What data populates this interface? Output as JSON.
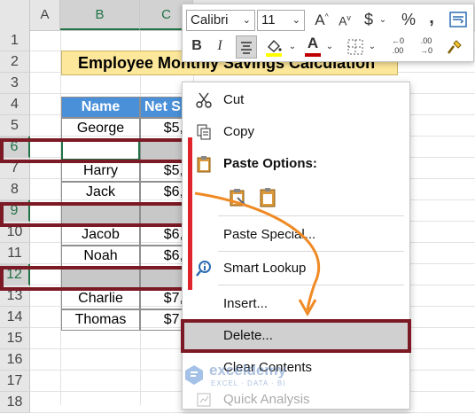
{
  "columns": [
    {
      "label": "A",
      "selected": false
    },
    {
      "label": "B",
      "selected": true
    },
    {
      "label": "C",
      "selected": true
    }
  ],
  "rows": [
    {
      "num": "1",
      "selected": false
    },
    {
      "num": "2",
      "selected": false
    },
    {
      "num": "3",
      "selected": false
    },
    {
      "num": "4",
      "selected": false
    },
    {
      "num": "5",
      "selected": false
    },
    {
      "num": "6",
      "selected": true
    },
    {
      "num": "7",
      "selected": false
    },
    {
      "num": "8",
      "selected": false
    },
    {
      "num": "9",
      "selected": true
    },
    {
      "num": "10",
      "selected": false
    },
    {
      "num": "11",
      "selected": false
    },
    {
      "num": "12",
      "selected": true
    },
    {
      "num": "13",
      "selected": false
    },
    {
      "num": "14",
      "selected": false
    },
    {
      "num": "15",
      "selected": false
    },
    {
      "num": "16",
      "selected": false
    },
    {
      "num": "17",
      "selected": false
    },
    {
      "num": "18",
      "selected": false
    }
  ],
  "sheet": {
    "title": "Employee Monthly Savings Calculation",
    "headers": [
      "Name",
      "Net S"
    ],
    "records": [
      {
        "name": "George",
        "net": "$5,"
      },
      {
        "name": "",
        "net": ""
      },
      {
        "name": "Harry",
        "net": "$5,"
      },
      {
        "name": "Jack",
        "net": "$6,"
      },
      {
        "name": "",
        "net": ""
      },
      {
        "name": "Jacob",
        "net": "$6,"
      },
      {
        "name": "Noah",
        "net": "$6,"
      },
      {
        "name": "",
        "net": ""
      },
      {
        "name": "Charlie",
        "net": "$7,"
      },
      {
        "name": "Thomas",
        "net": "$7,"
      }
    ]
  },
  "mini_toolbar": {
    "font_name": "Calibri",
    "font_size": "11",
    "grow_font": "A",
    "shrink_font": "A",
    "currency": "$",
    "percent": "%",
    "comma": ",",
    "bold": "B",
    "italic": "I",
    "font_color_letter": "A",
    "dec_increase_top": "←0",
    "dec_increase_bottom": ".00",
    "dec_decrease_top": ".00",
    "dec_decrease_bottom": "→0",
    "font_color_accent": "#ffff00",
    "font_color_bar": "#c00000"
  },
  "context_menu": {
    "cut": "Cut",
    "copy": "Copy",
    "paste_options": "Paste Options:",
    "paste_special": "Paste Special...",
    "smart_lookup": "Smart Lookup",
    "insert": "Insert...",
    "delete": "Delete...",
    "clear_contents": "Clear Contents",
    "quick_analysis": "Quick Analysis"
  },
  "watermark": {
    "name": "exceldemy",
    "tagline": "EXCEL · DATA · BI"
  },
  "colors": {
    "accent_red": "#7b1a25",
    "header_blue": "#4a90d9",
    "title_fill": "#fde79a",
    "arrow_orange": "#f08a24",
    "selection_red": "#e0242b"
  }
}
